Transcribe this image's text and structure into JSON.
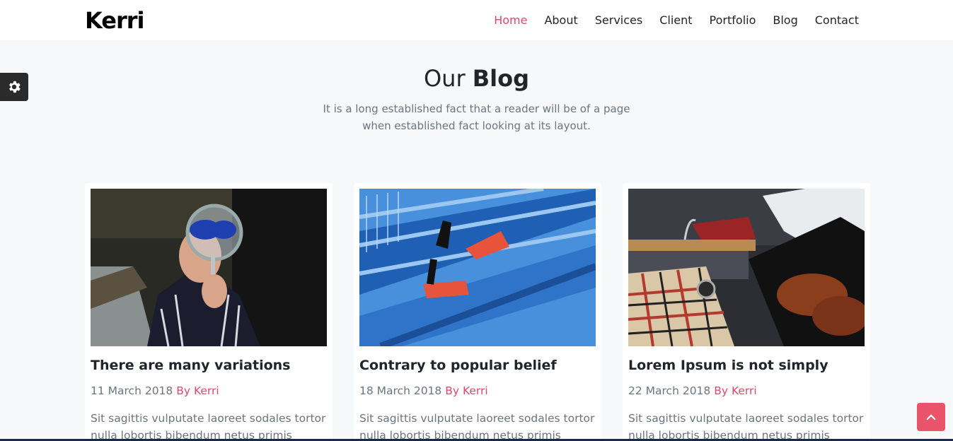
{
  "brand": {
    "logo": "Kerri"
  },
  "nav": {
    "items": [
      "Home",
      "About",
      "Services",
      "Client",
      "Portfolio",
      "Blog",
      "Contact"
    ],
    "active": "Home"
  },
  "settings": {
    "icon": "gear-icon"
  },
  "section": {
    "title_light": "Our",
    "title_bold": "Blog",
    "description": "It is a long established fact that a reader will be of a page when established fact looking at its layout."
  },
  "posts": [
    {
      "title": "There are many variations",
      "date": "11 March 2018",
      "author": "By Kerri",
      "excerpt": "Sit sagittis vulputate laoreet sodales tortor nulla lobortis bibendum netus primis fames",
      "image": "person-with-magnifying-glass"
    },
    {
      "title": "Contrary to popular belief",
      "date": "18 March 2018",
      "author": "By Kerri",
      "excerpt": "Sit sagittis vulputate laoreet sodales tortor nulla lobortis bibendum netus primis fames",
      "image": "blue-stairs-red-sneakers"
    },
    {
      "title": "Lorem Ipsum is not simply",
      "date": "22 March 2018",
      "author": "By Kerri",
      "excerpt": "Sit sagittis vulputate laoreet sodales tortor nulla lobortis bibendum netus primis fames",
      "image": "menswear-shoes-watch"
    }
  ],
  "back_to_top": {
    "icon": "chevron-up-icon"
  },
  "colors": {
    "accent": "#e04869",
    "dark": "#2b2b2b",
    "background": "#f7f8fa"
  }
}
